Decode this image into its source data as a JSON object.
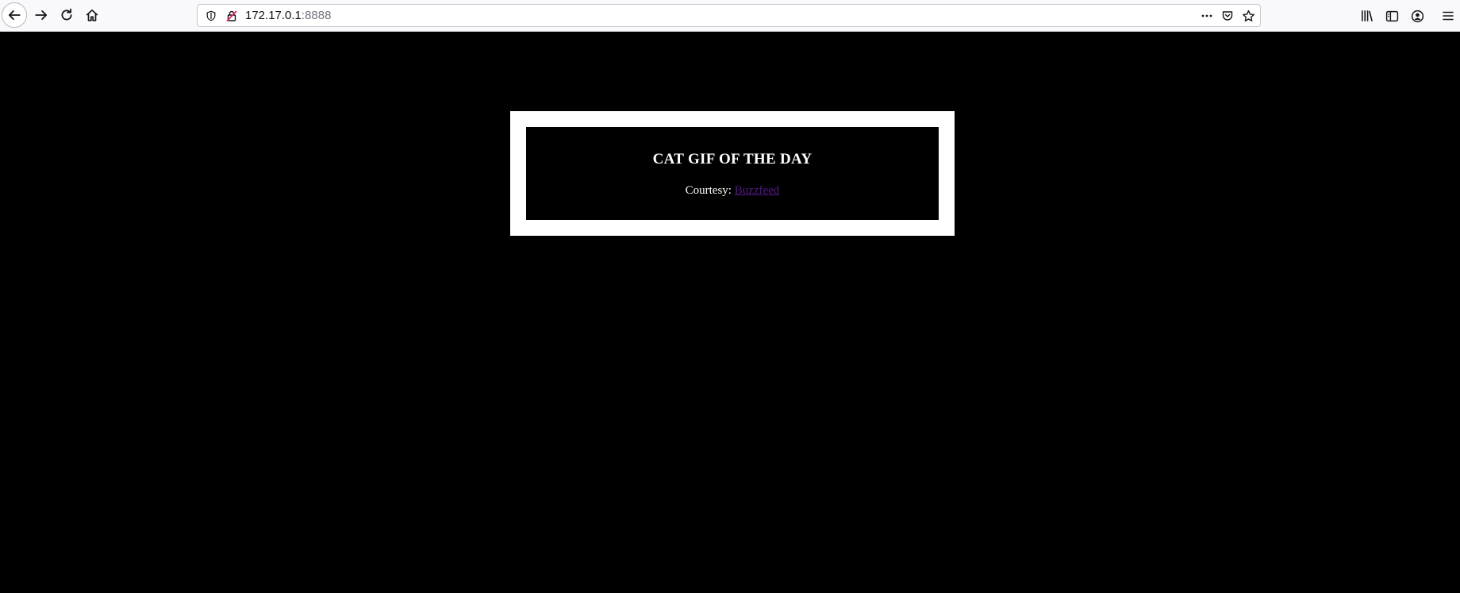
{
  "browser": {
    "url_host": "172.17.0.1",
    "url_port": ":8888",
    "icons": {
      "back": "back-arrow-icon",
      "forward": "forward-arrow-icon",
      "reload": "reload-icon",
      "home": "home-icon",
      "shield": "shield-icon",
      "insecure": "insecure-connection-icon",
      "more": "more-icon",
      "pocket": "pocket-icon",
      "bookmark": "star-icon",
      "library": "library-icon",
      "sidebar": "sidebar-icon",
      "account": "account-icon",
      "menu": "hamburger-menu-icon"
    }
  },
  "page": {
    "title": "CAT GIF OF THE DAY",
    "courtesy_label": "Courtesy:",
    "courtesy_link": "Buzzfeed",
    "colors": {
      "background": "#000000",
      "frame": "#ffffff",
      "text": "#ffffff",
      "visited_link": "#551a8b"
    }
  }
}
